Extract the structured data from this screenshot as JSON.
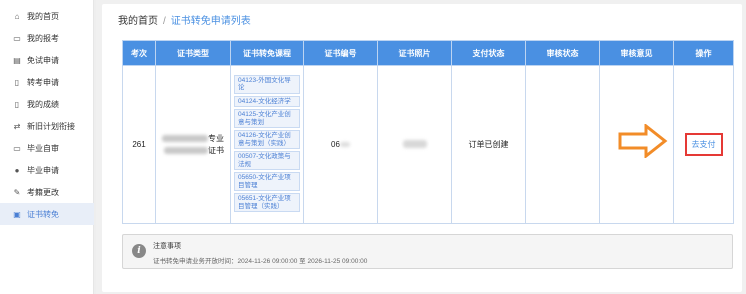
{
  "sidebar": {
    "items": [
      {
        "label": "我的首页",
        "icon": "home-icon",
        "glyph": "⌂"
      },
      {
        "label": "我的报考",
        "icon": "folder-icon",
        "glyph": "▭"
      },
      {
        "label": "免试申请",
        "icon": "form-icon",
        "glyph": "▤"
      },
      {
        "label": "转考申请",
        "icon": "document-icon",
        "glyph": "▯"
      },
      {
        "label": "我的成绩",
        "icon": "report-icon",
        "glyph": "▯"
      },
      {
        "label": "新旧计划衔接",
        "icon": "swap-icon",
        "glyph": "⇄"
      },
      {
        "label": "毕业自审",
        "icon": "audit-icon",
        "glyph": "▭"
      },
      {
        "label": "毕业申请",
        "icon": "user-icon",
        "glyph": "●"
      },
      {
        "label": "考籍更改",
        "icon": "edit-icon",
        "glyph": "✎"
      },
      {
        "label": "证书转免",
        "icon": "certificate-icon",
        "glyph": "▣"
      }
    ],
    "active_index": 9
  },
  "breadcrumb": {
    "home": "我的首页",
    "separator": "/",
    "current": "证书转免申请列表"
  },
  "table": {
    "headers": [
      "考次",
      "证书类型",
      "证书转免课程",
      "证书编号",
      "证书照片",
      "支付状态",
      "审核状态",
      "审核意见",
      "操作"
    ],
    "row": {
      "exam_session": "261",
      "cert_type_suffix_1": "专业",
      "cert_type_suffix_2": "证书",
      "courses": [
        "04123-外国文化导论",
        "04124-文化经济学",
        "04125-文化产业创意与策划",
        "04126-文化产业创意与策划（实践）",
        "00507-文化政策与法规",
        "05650-文化产业项目管理",
        "05651-文化产业项目管理（实践）"
      ],
      "cert_number_prefix": "06",
      "payment_status": "订单已创建",
      "review_status": "",
      "review_opinion": "",
      "action": "去支付"
    }
  },
  "notice": {
    "icon_glyph": "i",
    "title": "注意事项",
    "text": "证书转免申请业务开放时间：2024-11-26 09:00:00 至 2026-11-25 09:00:00"
  },
  "colors": {
    "accent": "#4a90e2",
    "arrow": "#f28c28",
    "highlight": "#e53935"
  }
}
